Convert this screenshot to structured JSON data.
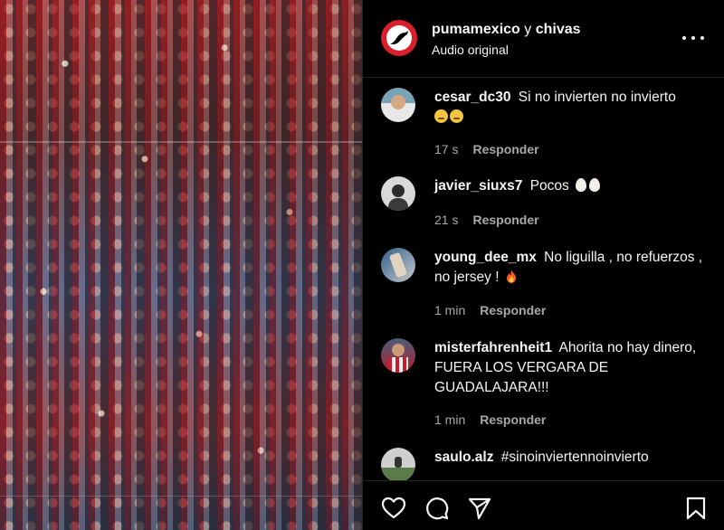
{
  "post": {
    "media_alt": "crowd",
    "header": {
      "author": "pumamexico",
      "joiner": "y",
      "collaborator": "chivas",
      "audio": "Audio original"
    }
  },
  "comments": [
    {
      "user": "cesar_dc30",
      "text": "Si no invierten no invierto",
      "emoji": [
        "face",
        "face"
      ],
      "time": "17 s",
      "reply": "Responder"
    },
    {
      "user": "javier_siuxs7",
      "text": "Pocos",
      "emoji": [
        "egg",
        "egg"
      ],
      "time": "21 s",
      "reply": "Responder"
    },
    {
      "user": "young_dee_mx",
      "text": "No liguilla , no refuerzos , no jersey !",
      "emoji": [
        "fire"
      ],
      "time": "1 min",
      "reply": "Responder"
    },
    {
      "user": "misterfahrenheit1",
      "text": "Ahorita no hay dinero, FUERA LOS VERGARA DE GUADALAJARA!!!",
      "emoji": [],
      "time": "1 min",
      "reply": "Responder"
    },
    {
      "user": "saulo.alz",
      "text": "#sinoinviertennoinvierto",
      "emoji": [],
      "time": "",
      "reply": ""
    }
  ],
  "icons": {
    "more": "more-options-icon",
    "like": "heart-icon",
    "comment": "comment-icon",
    "share": "send-icon",
    "save": "bookmark-icon"
  },
  "colors": {
    "background": "#000000",
    "text": "#f5f5f5",
    "muted": "#a8a8a8",
    "brand_red": "#d81f2b"
  }
}
